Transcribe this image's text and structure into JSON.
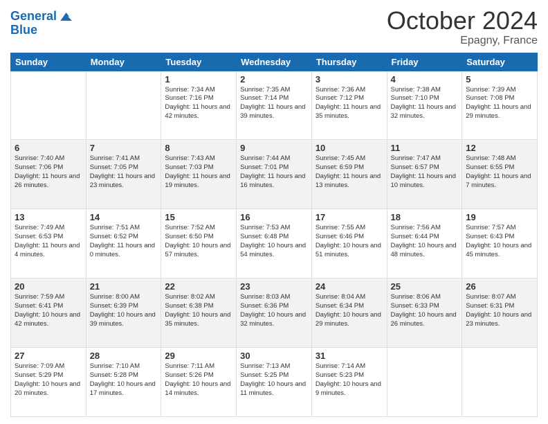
{
  "header": {
    "logo_line1": "General",
    "logo_line2": "Blue",
    "month": "October 2024",
    "location": "Epagny, France"
  },
  "days_of_week": [
    "Sunday",
    "Monday",
    "Tuesday",
    "Wednesday",
    "Thursday",
    "Friday",
    "Saturday"
  ],
  "weeks": [
    [
      {
        "day": "",
        "sunrise": "",
        "sunset": "",
        "daylight": ""
      },
      {
        "day": "",
        "sunrise": "",
        "sunset": "",
        "daylight": ""
      },
      {
        "day": "1",
        "sunrise": "Sunrise: 7:34 AM",
        "sunset": "Sunset: 7:16 PM",
        "daylight": "Daylight: 11 hours and 42 minutes."
      },
      {
        "day": "2",
        "sunrise": "Sunrise: 7:35 AM",
        "sunset": "Sunset: 7:14 PM",
        "daylight": "Daylight: 11 hours and 39 minutes."
      },
      {
        "day": "3",
        "sunrise": "Sunrise: 7:36 AM",
        "sunset": "Sunset: 7:12 PM",
        "daylight": "Daylight: 11 hours and 35 minutes."
      },
      {
        "day": "4",
        "sunrise": "Sunrise: 7:38 AM",
        "sunset": "Sunset: 7:10 PM",
        "daylight": "Daylight: 11 hours and 32 minutes."
      },
      {
        "day": "5",
        "sunrise": "Sunrise: 7:39 AM",
        "sunset": "Sunset: 7:08 PM",
        "daylight": "Daylight: 11 hours and 29 minutes."
      }
    ],
    [
      {
        "day": "6",
        "sunrise": "Sunrise: 7:40 AM",
        "sunset": "Sunset: 7:06 PM",
        "daylight": "Daylight: 11 hours and 26 minutes."
      },
      {
        "day": "7",
        "sunrise": "Sunrise: 7:41 AM",
        "sunset": "Sunset: 7:05 PM",
        "daylight": "Daylight: 11 hours and 23 minutes."
      },
      {
        "day": "8",
        "sunrise": "Sunrise: 7:43 AM",
        "sunset": "Sunset: 7:03 PM",
        "daylight": "Daylight: 11 hours and 19 minutes."
      },
      {
        "day": "9",
        "sunrise": "Sunrise: 7:44 AM",
        "sunset": "Sunset: 7:01 PM",
        "daylight": "Daylight: 11 hours and 16 minutes."
      },
      {
        "day": "10",
        "sunrise": "Sunrise: 7:45 AM",
        "sunset": "Sunset: 6:59 PM",
        "daylight": "Daylight: 11 hours and 13 minutes."
      },
      {
        "day": "11",
        "sunrise": "Sunrise: 7:47 AM",
        "sunset": "Sunset: 6:57 PM",
        "daylight": "Daylight: 11 hours and 10 minutes."
      },
      {
        "day": "12",
        "sunrise": "Sunrise: 7:48 AM",
        "sunset": "Sunset: 6:55 PM",
        "daylight": "Daylight: 11 hours and 7 minutes."
      }
    ],
    [
      {
        "day": "13",
        "sunrise": "Sunrise: 7:49 AM",
        "sunset": "Sunset: 6:53 PM",
        "daylight": "Daylight: 11 hours and 4 minutes."
      },
      {
        "day": "14",
        "sunrise": "Sunrise: 7:51 AM",
        "sunset": "Sunset: 6:52 PM",
        "daylight": "Daylight: 11 hours and 0 minutes."
      },
      {
        "day": "15",
        "sunrise": "Sunrise: 7:52 AM",
        "sunset": "Sunset: 6:50 PM",
        "daylight": "Daylight: 10 hours and 57 minutes."
      },
      {
        "day": "16",
        "sunrise": "Sunrise: 7:53 AM",
        "sunset": "Sunset: 6:48 PM",
        "daylight": "Daylight: 10 hours and 54 minutes."
      },
      {
        "day": "17",
        "sunrise": "Sunrise: 7:55 AM",
        "sunset": "Sunset: 6:46 PM",
        "daylight": "Daylight: 10 hours and 51 minutes."
      },
      {
        "day": "18",
        "sunrise": "Sunrise: 7:56 AM",
        "sunset": "Sunset: 6:44 PM",
        "daylight": "Daylight: 10 hours and 48 minutes."
      },
      {
        "day": "19",
        "sunrise": "Sunrise: 7:57 AM",
        "sunset": "Sunset: 6:43 PM",
        "daylight": "Daylight: 10 hours and 45 minutes."
      }
    ],
    [
      {
        "day": "20",
        "sunrise": "Sunrise: 7:59 AM",
        "sunset": "Sunset: 6:41 PM",
        "daylight": "Daylight: 10 hours and 42 minutes."
      },
      {
        "day": "21",
        "sunrise": "Sunrise: 8:00 AM",
        "sunset": "Sunset: 6:39 PM",
        "daylight": "Daylight: 10 hours and 39 minutes."
      },
      {
        "day": "22",
        "sunrise": "Sunrise: 8:02 AM",
        "sunset": "Sunset: 6:38 PM",
        "daylight": "Daylight: 10 hours and 35 minutes."
      },
      {
        "day": "23",
        "sunrise": "Sunrise: 8:03 AM",
        "sunset": "Sunset: 6:36 PM",
        "daylight": "Daylight: 10 hours and 32 minutes."
      },
      {
        "day": "24",
        "sunrise": "Sunrise: 8:04 AM",
        "sunset": "Sunset: 6:34 PM",
        "daylight": "Daylight: 10 hours and 29 minutes."
      },
      {
        "day": "25",
        "sunrise": "Sunrise: 8:06 AM",
        "sunset": "Sunset: 6:33 PM",
        "daylight": "Daylight: 10 hours and 26 minutes."
      },
      {
        "day": "26",
        "sunrise": "Sunrise: 8:07 AM",
        "sunset": "Sunset: 6:31 PM",
        "daylight": "Daylight: 10 hours and 23 minutes."
      }
    ],
    [
      {
        "day": "27",
        "sunrise": "Sunrise: 7:09 AM",
        "sunset": "Sunset: 5:29 PM",
        "daylight": "Daylight: 10 hours and 20 minutes."
      },
      {
        "day": "28",
        "sunrise": "Sunrise: 7:10 AM",
        "sunset": "Sunset: 5:28 PM",
        "daylight": "Daylight: 10 hours and 17 minutes."
      },
      {
        "day": "29",
        "sunrise": "Sunrise: 7:11 AM",
        "sunset": "Sunset: 5:26 PM",
        "daylight": "Daylight: 10 hours and 14 minutes."
      },
      {
        "day": "30",
        "sunrise": "Sunrise: 7:13 AM",
        "sunset": "Sunset: 5:25 PM",
        "daylight": "Daylight: 10 hours and 11 minutes."
      },
      {
        "day": "31",
        "sunrise": "Sunrise: 7:14 AM",
        "sunset": "Sunset: 5:23 PM",
        "daylight": "Daylight: 10 hours and 9 minutes."
      },
      {
        "day": "",
        "sunrise": "",
        "sunset": "",
        "daylight": ""
      },
      {
        "day": "",
        "sunrise": "",
        "sunset": "",
        "daylight": ""
      }
    ]
  ]
}
